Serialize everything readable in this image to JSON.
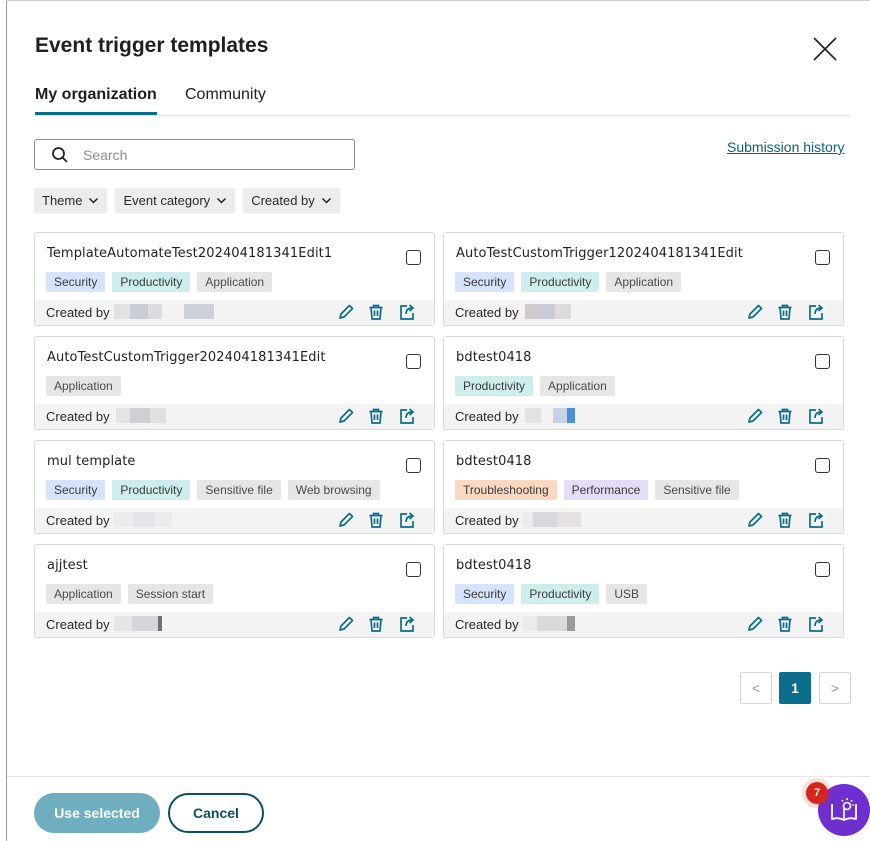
{
  "dialog": {
    "title": "Event trigger templates",
    "close_icon": "close-icon"
  },
  "tabs": [
    {
      "label": "My organization",
      "active": true
    },
    {
      "label": "Community",
      "active": false
    }
  ],
  "search": {
    "placeholder": "Search",
    "value": ""
  },
  "submission_history": "Submission history",
  "filters": [
    {
      "label": "Theme"
    },
    {
      "label": "Event category"
    },
    {
      "label": "Created by"
    }
  ],
  "created_by_label": "Created by",
  "cards": [
    {
      "name": "TemplateAutomateTest202404181341Edit1",
      "tags": [
        "Security",
        "Productivity",
        "Application"
      ]
    },
    {
      "name": "AutoTestCustomTrigger1202404181341Edit",
      "tags": [
        "Security",
        "Productivity",
        "Application"
      ]
    },
    {
      "name": "AutoTestCustomTrigger202404181341Edit",
      "tags": [
        "Application"
      ]
    },
    {
      "name": "bdtest0418",
      "tags": [
        "Productivity",
        "Application"
      ]
    },
    {
      "name": "mul template",
      "tags": [
        "Security",
        "Productivity",
        "Sensitive file",
        "Web browsing"
      ]
    },
    {
      "name": "bdtest0418",
      "tags": [
        "Troubleshooting",
        "Performance",
        "Sensitive file"
      ]
    },
    {
      "name": "ajjtest",
      "tags": [
        "Application",
        "Session start"
      ]
    },
    {
      "name": "bdtest0418",
      "tags": [
        "Security",
        "Productivity",
        "USB"
      ]
    }
  ],
  "pagination": {
    "current": "1",
    "prev": "<",
    "next": ">"
  },
  "footer": {
    "use_selected": "Use selected",
    "cancel": "Cancel"
  },
  "help": {
    "badge_count": "7"
  },
  "colors": {
    "accent": "#0b6e8a",
    "use_selected_bg": "#6faebf",
    "help_bg": "#6e2fd0",
    "badge_bg": "#d6261c",
    "tag_security": "#d6e4fb",
    "tag_productivity": "#cdeeed",
    "tag_neutral": "#e6e6e6",
    "tag_troubleshooting": "#fbd8c2",
    "tag_performance": "#e5dcf8"
  }
}
